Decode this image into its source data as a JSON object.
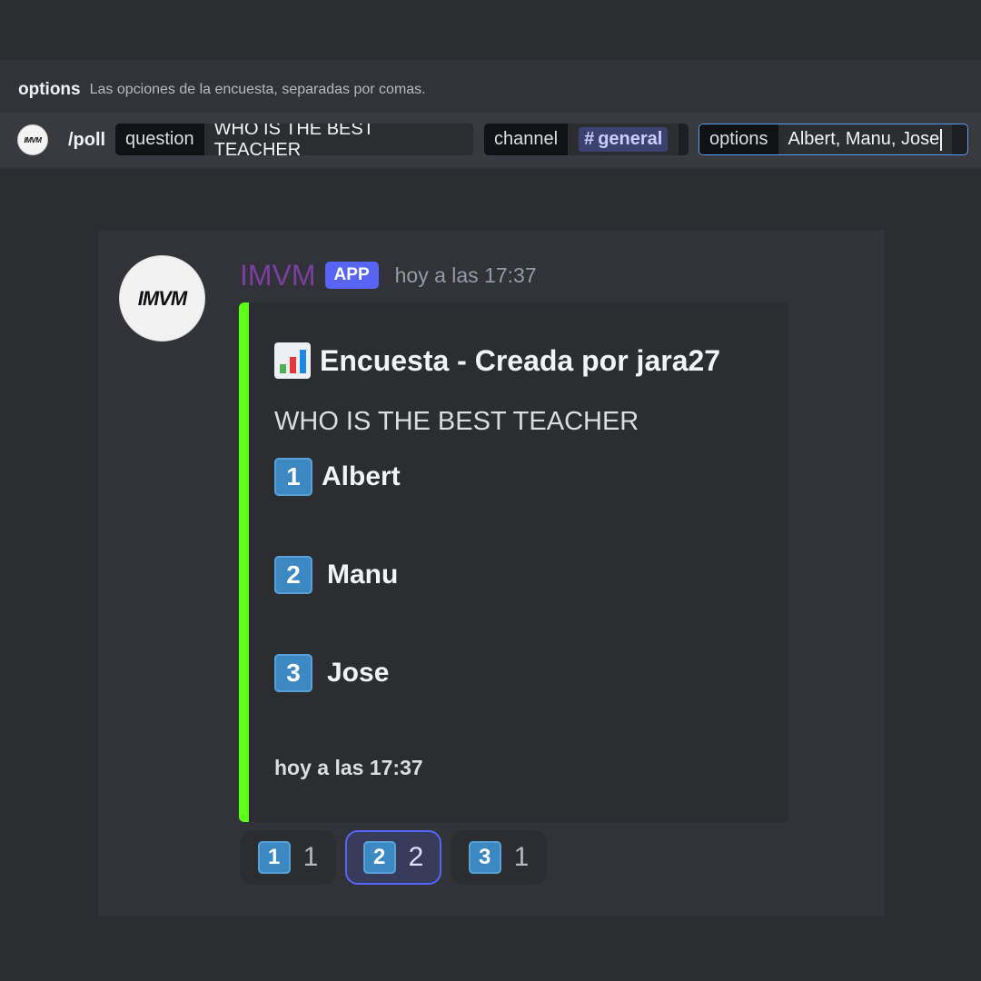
{
  "command_hint": {
    "option_name": "options",
    "option_description": "Las opciones de la encuesta, separadas por comas."
  },
  "command_bar": {
    "command": "/poll",
    "params": [
      {
        "label": "question",
        "value": "WHO IS THE BEST TEACHER"
      },
      {
        "label": "channel",
        "value": "general"
      },
      {
        "label": "options",
        "value": "Albert, Manu, Jose"
      }
    ],
    "channel_prefix": "#"
  },
  "message": {
    "author": "IMVM",
    "badge": "APP",
    "timestamp": "hoy a las 17:37",
    "author_color": "#7b3fa0",
    "embed": {
      "accent_color": "#5cff1a",
      "icon": "bar-chart-icon",
      "title": "Encuesta - Creada por jara27",
      "question": "WHO IS THE BEST TEACHER",
      "options": [
        {
          "number": "1",
          "label": "Albert"
        },
        {
          "number": "2",
          "label": "Manu"
        },
        {
          "number": "3",
          "label": "Jose"
        }
      ],
      "footer": "hoy a las 17:37"
    },
    "reactions": [
      {
        "emoji": "1",
        "count": "1",
        "active": false
      },
      {
        "emoji": "2",
        "count": "2",
        "active": true
      },
      {
        "emoji": "3",
        "count": "1",
        "active": false
      }
    ]
  },
  "logo_text": "IMVM"
}
